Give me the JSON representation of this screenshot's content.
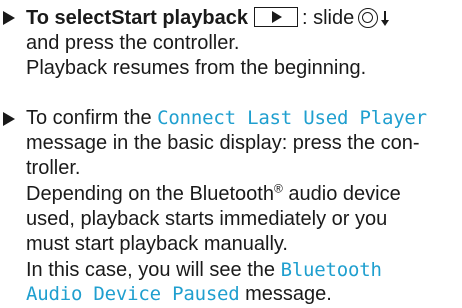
{
  "step1": {
    "bold_text": "To selectStart playback",
    "after_button": ":",
    "slide_text": " slide",
    "line2": "and press the controller.",
    "line3": "Playback resumes from the beginning."
  },
  "step2": {
    "line1_prefix": "To confirm the",
    "display_message_1": "Connect Last Used Player",
    "line2": "message in the basic display: press the con-",
    "line3": "troller.",
    "line4_prefix": "Depending on the Bluetooth",
    "line4_sup": "®",
    "line4_suffix": " audio device",
    "line5": "used, playback starts immediately or you",
    "line6": "must start playback manually.",
    "line7_prefix": "In this case, you will see the",
    "display_message_2_part1": "Bluetooth",
    "display_message_2_part2": "Audio Device Paused",
    "line8_suffix": " message."
  }
}
